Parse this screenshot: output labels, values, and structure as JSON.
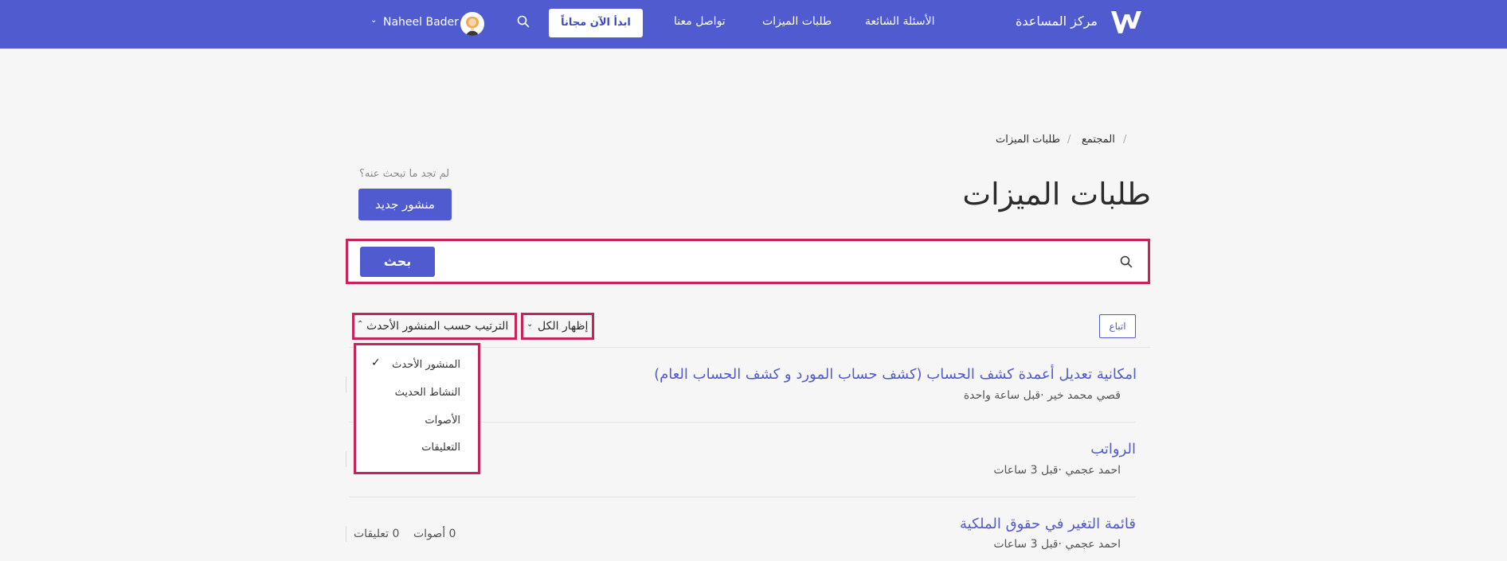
{
  "header": {
    "brand": "مركز المساعدة",
    "nav": {
      "faq": "الأسئلة الشائعة",
      "features": "طلبات الميزات",
      "contact": "تواصل معنا"
    },
    "cta": "ابدأ الآن مجاناً",
    "user_name": "Naheel Bader"
  },
  "breadcrumb": {
    "community": "المجتمع",
    "current": "طلبات الميزات"
  },
  "page": {
    "title": "طلبات الميزات",
    "hint": "لم تجد ما تبحث عنه؟",
    "new_post": "منشور جديد"
  },
  "search": {
    "button": "بحث",
    "value": ""
  },
  "filters": {
    "follow": "اتباع",
    "show_all": "إظهار الكل",
    "sort": "الترتيب حسب المنشور الأحدث"
  },
  "sort_menu": {
    "options": [
      "المنشور الأحدث",
      "النشاط الحديث",
      "الأصوات",
      "التعليقات"
    ],
    "selected": "المنشور الأحدث"
  },
  "posts": [
    {
      "title": "امكانية تعديل أعمدة كشف الحساب (كشف حساب المورد و كشف الحساب العام)",
      "author": "قصي محمد خير",
      "time": "قبل ساعة واحدة"
    },
    {
      "title": "الرواتب",
      "author": "احمد عجمي",
      "time": "قبل 3 ساعات"
    },
    {
      "title": "قائمة التغير في حقوق الملكية",
      "author": "احمد عجمي",
      "time": "قبل 3 ساعات",
      "votes": "0",
      "votes_label": "أصوات",
      "comments": "0",
      "comments_label": "تعليقات"
    }
  ],
  "colors": {
    "brand": "#515bd0",
    "highlight": "#c9245a"
  }
}
